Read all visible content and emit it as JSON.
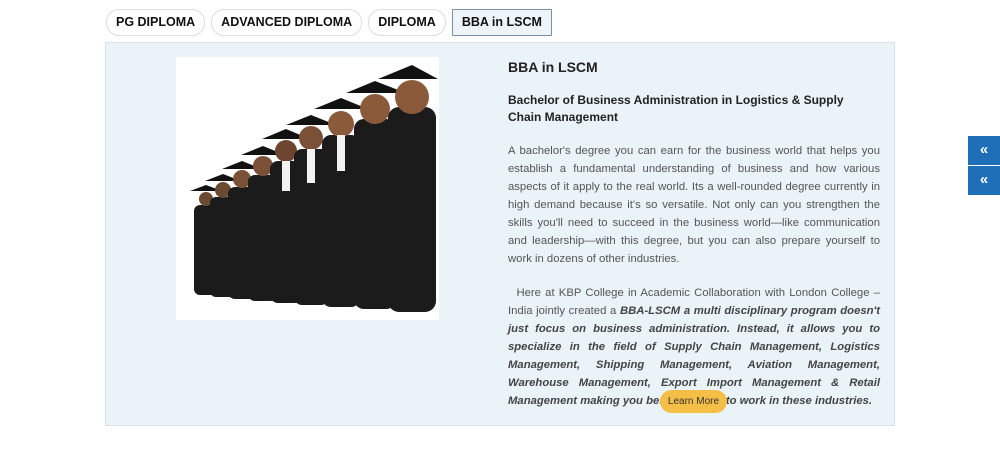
{
  "tabs": [
    {
      "label": "PG DIPLOMA"
    },
    {
      "label": "ADVANCED DIPLOMA"
    },
    {
      "label": "DIPLOMA"
    },
    {
      "label": "BBA in LSCM"
    }
  ],
  "panel": {
    "title": "BBA in LSCM",
    "subtitle": "Bachelor of Business Administration in Logistics & Supply Chain Management",
    "paragraph1": "A bachelor's degree you can earn for the business world that helps you establish a fundamental understanding of business and how various aspects of it apply to the real world. Its a well-rounded degree currently in high demand because it's so versatile. Not only can you strengthen the skills you'll need to succeed in the business world—like communication and leadership—with this degree, but you can also prepare yourself to work in dozens of other industries.",
    "paragraph2_plain": "Here at KBP College in Academic Collaboration with London College – India jointly created a ",
    "paragraph2_emphasis": "BBA-LSCM a multi disciplinary program doesn't just focus on business administration. Instead, it allows you to specialize in the field of Supply Chain Management, Logistics Management, Shipping Management, Aviation Management, Warehouse Management, Export Import Management & Retail Management making you best equipped to work in these industries.",
    "learn_more": "Learn More",
    "image_icon": "graduates-photo"
  },
  "side_buttons": [
    {
      "icon": "double-chevron-left-icon",
      "glyph": "«"
    },
    {
      "icon": "double-chevron-left-icon",
      "glyph": "«"
    }
  ],
  "colors": {
    "panel_bg": "#eaf3f8",
    "button_yellow": "#f5bf47",
    "side_blue": "#1e6fb8"
  }
}
